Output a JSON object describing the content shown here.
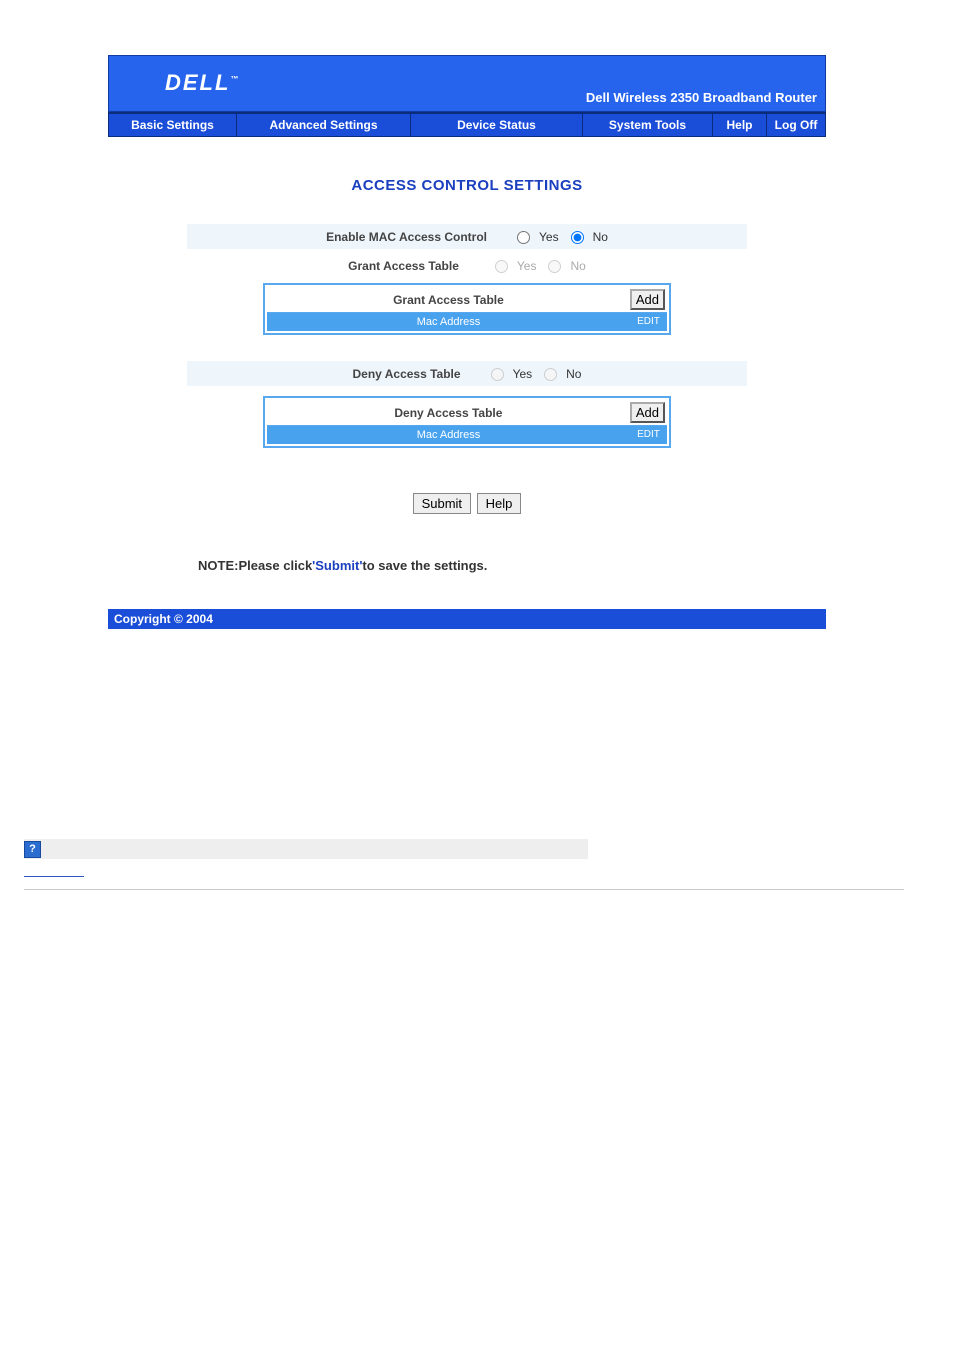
{
  "header": {
    "logo_text": "DELL",
    "logo_tm": "™",
    "device_name": "Dell Wireless 2350 Broadband Router"
  },
  "nav": {
    "basic": "Basic Settings",
    "advanced": "Advanced Settings",
    "status": "Device Status",
    "tools": "System Tools",
    "help": "Help",
    "logoff": "Log Off"
  },
  "page_title": "ACCESS CONTROL SETTINGS",
  "enable_mac": {
    "label": "Enable MAC Access Control",
    "yes": "Yes",
    "no": "No"
  },
  "grant": {
    "toggle_label": "Grant Access Table",
    "yes": "Yes",
    "no": "No",
    "table_title": "Grant Access Table",
    "add_btn": "Add",
    "mac_header": "Mac Address",
    "edit_header": "EDIT"
  },
  "deny": {
    "toggle_label": "Deny Access Table",
    "yes": "Yes",
    "no": "No",
    "table_title": "Deny Access Table",
    "add_btn": "Add",
    "mac_header": "Mac Address",
    "edit_header": "EDIT"
  },
  "actions": {
    "submit": "Submit",
    "help": "Help"
  },
  "note": {
    "prefix": "NOTE:Please click",
    "submit_word": "'Submit'",
    "suffix": "to save the settings."
  },
  "footer": "Copyright © 2004",
  "help_icon": "?"
}
